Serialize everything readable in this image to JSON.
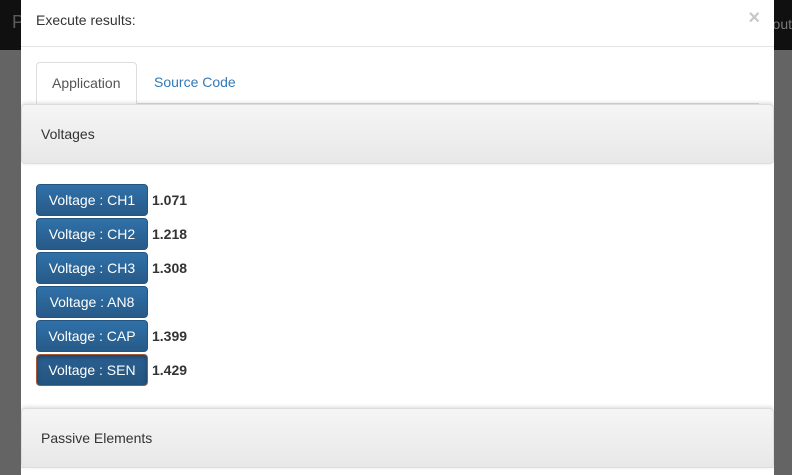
{
  "background": {
    "topbar_left": "P",
    "topbar_right": "out"
  },
  "modal": {
    "title": "Execute results:",
    "close_label": "×",
    "tabs": [
      {
        "label": "Application",
        "active": true
      },
      {
        "label": "Source Code",
        "active": false
      }
    ],
    "voltages_panel_title": "Voltages",
    "passive_panel_title": "Passive Elements",
    "voltages": [
      {
        "label": "Voltage : CH1",
        "value": "1.071"
      },
      {
        "label": "Voltage : CH2",
        "value": "1.218"
      },
      {
        "label": "Voltage : CH3",
        "value": "1.308"
      },
      {
        "label": "Voltage : AN8",
        "value": ""
      },
      {
        "label": "Voltage : CAP",
        "value": "1.399"
      },
      {
        "label": "Voltage : SEN",
        "value": "1.429"
      }
    ]
  },
  "colors": {
    "button_blue": "#2a6aa2",
    "link_blue": "#337ab7",
    "backdrop_gray": "#646464"
  }
}
